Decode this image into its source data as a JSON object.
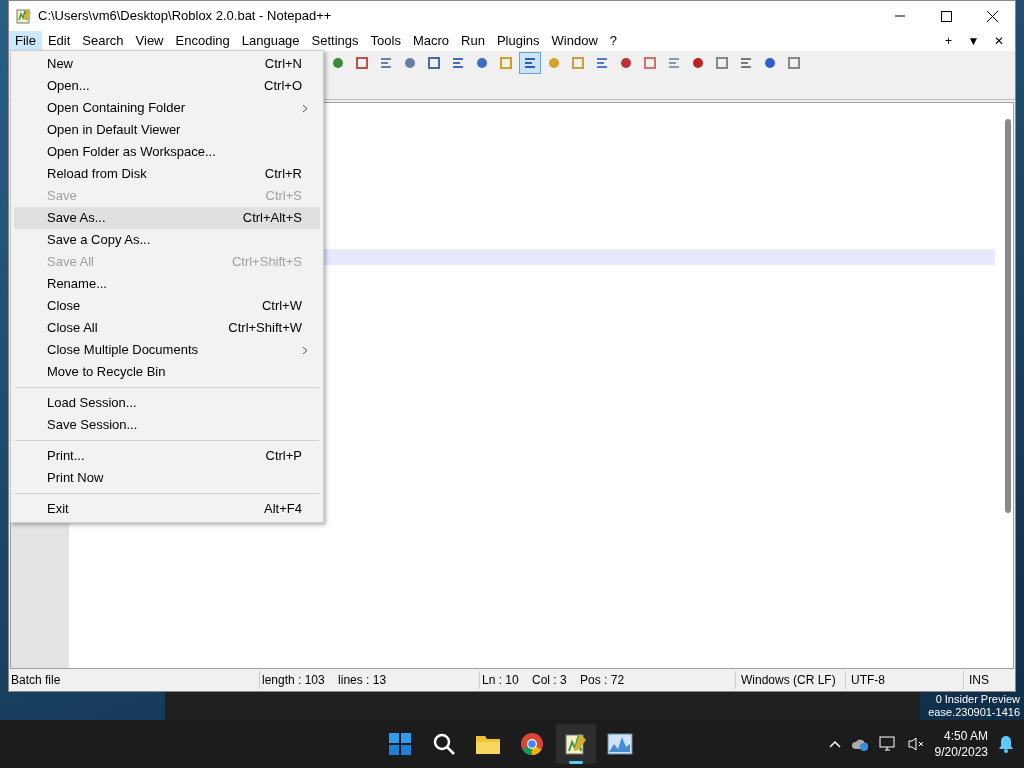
{
  "window": {
    "title": "C:\\Users\\vm6\\Desktop\\Roblox 2.0.bat - Notepad++"
  },
  "menu_bar": [
    {
      "label": "File",
      "selected": true
    },
    {
      "label": "Edit",
      "selected": false
    },
    {
      "label": "Search",
      "selected": false
    },
    {
      "label": "View",
      "selected": false
    },
    {
      "label": "Encoding",
      "selected": false
    },
    {
      "label": "Language",
      "selected": false
    },
    {
      "label": "Settings",
      "selected": false
    },
    {
      "label": "Tools",
      "selected": false
    },
    {
      "label": "Macro",
      "selected": false
    },
    {
      "label": "Run",
      "selected": false
    },
    {
      "label": "Plugins",
      "selected": false
    },
    {
      "label": "Window",
      "selected": false
    },
    {
      "label": "?",
      "selected": false
    }
  ],
  "menu_bar_right": [
    "+",
    "▼",
    "✕"
  ],
  "toolbar": [
    {
      "pressed": false
    },
    {
      "pressed": false
    },
    {
      "pressed": false
    },
    {
      "pressed": false
    },
    {
      "pressed": false
    },
    {
      "pressed": false
    },
    {
      "pressed": false
    },
    {
      "pressed": false
    },
    {
      "pressed": true
    },
    {
      "pressed": false
    },
    {
      "pressed": false
    },
    {
      "pressed": false
    },
    {
      "pressed": false
    },
    {
      "pressed": false
    },
    {
      "pressed": false
    },
    {
      "pressed": false
    },
    {
      "pressed": false
    },
    {
      "pressed": false
    },
    {
      "pressed": false
    },
    {
      "pressed": false
    }
  ],
  "file_menu": [
    {
      "kind": "item",
      "label": "New",
      "shortcut": "Ctrl+N",
      "disabled": false,
      "selected": false,
      "submenu": false
    },
    {
      "kind": "item",
      "label": "Open...",
      "shortcut": "Ctrl+O",
      "disabled": false,
      "selected": false,
      "submenu": false
    },
    {
      "kind": "item",
      "label": "Open Containing Folder",
      "disabled": false,
      "selected": false,
      "submenu": true
    },
    {
      "kind": "item",
      "label": "Open in Default Viewer",
      "disabled": false,
      "selected": false,
      "submenu": false
    },
    {
      "kind": "item",
      "label": "Open Folder as Workspace...",
      "disabled": false,
      "selected": false,
      "submenu": false
    },
    {
      "kind": "item",
      "label": "Reload from Disk",
      "shortcut": "Ctrl+R",
      "disabled": false,
      "selected": false,
      "submenu": false
    },
    {
      "kind": "item",
      "label": "Save",
      "shortcut": "Ctrl+S",
      "disabled": true,
      "selected": false,
      "submenu": false
    },
    {
      "kind": "item",
      "label": "Save As...",
      "shortcut": "Ctrl+Alt+S",
      "disabled": false,
      "selected": true,
      "submenu": false
    },
    {
      "kind": "item",
      "label": "Save a Copy As...",
      "disabled": false,
      "selected": false,
      "submenu": false
    },
    {
      "kind": "item",
      "label": "Save All",
      "shortcut": "Ctrl+Shift+S",
      "disabled": true,
      "selected": false,
      "submenu": false
    },
    {
      "kind": "item",
      "label": "Rename...",
      "disabled": false,
      "selected": false,
      "submenu": false
    },
    {
      "kind": "item",
      "label": "Close",
      "shortcut": "Ctrl+W",
      "disabled": false,
      "selected": false,
      "submenu": false
    },
    {
      "kind": "item",
      "label": "Close All",
      "shortcut": "Ctrl+Shift+W",
      "disabled": false,
      "selected": false,
      "submenu": false
    },
    {
      "kind": "item",
      "label": "Close Multiple Documents",
      "disabled": false,
      "selected": false,
      "submenu": true
    },
    {
      "kind": "item",
      "label": "Move to Recycle Bin",
      "disabled": false,
      "selected": false,
      "submenu": false
    },
    {
      "kind": "separator"
    },
    {
      "kind": "item",
      "label": "Load Session...",
      "disabled": false,
      "selected": false,
      "submenu": false
    },
    {
      "kind": "item",
      "label": "Save Session...",
      "disabled": false,
      "selected": false,
      "submenu": false
    },
    {
      "kind": "separator"
    },
    {
      "kind": "item",
      "label": "Print...",
      "shortcut": "Ctrl+P",
      "disabled": false,
      "selected": false,
      "submenu": false
    },
    {
      "kind": "item",
      "label": "Print Now",
      "disabled": false,
      "selected": false,
      "submenu": false
    },
    {
      "kind": "separator"
    },
    {
      "kind": "item",
      "label": "Exit",
      "shortcut": "Alt+F4",
      "disabled": false,
      "selected": false,
      "submenu": false
    }
  ],
  "status_bar": [
    "Batch file",
    "length : 103    lines : 13",
    "Ln : 10    Col : 3    Pos : 72",
    "Windows (CR LF)",
    "UTF-8",
    "INS"
  ],
  "desktop_text": [
    "0 Insider Preview",
    "ease.230901-1416"
  ],
  "taskbar": {
    "apps": [
      {
        "kind": "start",
        "active": false
      },
      {
        "kind": "search",
        "active": false
      },
      {
        "kind": "folder",
        "active": false
      },
      {
        "kind": "browser",
        "active": false
      },
      {
        "kind": "notepad",
        "active": true
      },
      {
        "kind": "monitor",
        "active": false
      }
    ],
    "time": "4:50 AM",
    "date": "9/20/2023"
  }
}
